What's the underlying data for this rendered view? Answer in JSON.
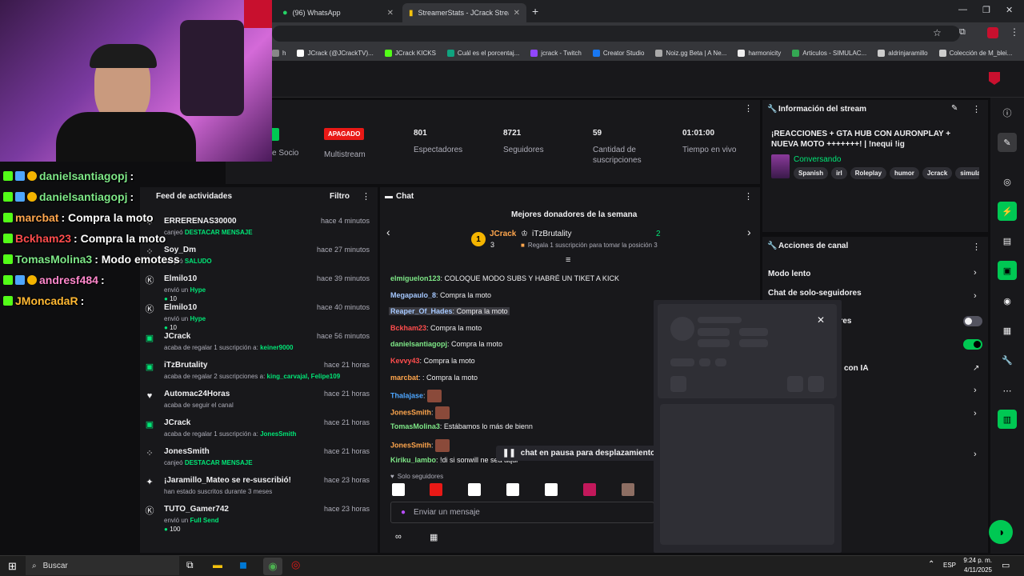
{
  "browser": {
    "tabs": [
      {
        "label": "(96) WhatsApp",
        "icon": "whatsapp-icon",
        "color": "#25d366"
      },
      {
        "label": "StreamerStats - JCrack Stream I",
        "icon": "streamerstats-icon",
        "color": "#f4c20d"
      }
    ],
    "new_tab": "+",
    "bookmarks": [
      {
        "label": "h",
        "color": "#888"
      },
      {
        "label": "JCrack (@JCrackTV)...",
        "color": "#fff"
      },
      {
        "label": "JCrack KICKS",
        "color": "#53fc18"
      },
      {
        "label": "Cuál es el porcentaj...",
        "color": "#10a37f"
      },
      {
        "label": "jcrack - Twitch",
        "color": "#9146ff"
      },
      {
        "label": "Creator Studio",
        "color": "#1877f2"
      },
      {
        "label": "Noiz.gg Beta | A Ne...",
        "color": "#aaa"
      },
      {
        "label": "harmonicity",
        "color": "#eee"
      },
      {
        "label": "Articulos - SIMULAC...",
        "color": "#34a853"
      },
      {
        "label": "aldrinjaramillo",
        "color": "#ccc"
      },
      {
        "label": "Colección de M_blei...",
        "color": "#ccc"
      }
    ]
  },
  "stats": {
    "partner_label": "e Socio",
    "multistream_badge": "APAGADO",
    "multistream_label": "Multistream",
    "items": [
      {
        "value": "801",
        "label": "Espectadores"
      },
      {
        "value": "8721",
        "label": "Seguidores"
      },
      {
        "value": "59",
        "label": "Cantidad de suscripciones"
      },
      {
        "value": "01:01:00",
        "label": "Tiempo en vivo"
      }
    ]
  },
  "stream_info": {
    "title": "Información del stream",
    "stream_title": "¡REACCIONES + GTA HUB CON AURONPLAY + NUEVA MOTO +++++++! | !nequi !ig",
    "category": "Conversando",
    "tags": [
      "Spanish",
      "irl",
      "Roleplay",
      "humor",
      "Jcrack",
      "simula"
    ]
  },
  "channel_actions": {
    "title": "Acciones de canal",
    "items": [
      "Modo lento",
      "Chat de solo-seguidores",
      "tores",
      "con IA"
    ]
  },
  "feed": {
    "title": "Feed de actividades",
    "filter": "Filtro",
    "items": [
      {
        "name": "ERRERENAS30000",
        "time": "hace 4 minutos",
        "desc": "canjeó",
        "highlight": "DESTACAR MENSAJE",
        "icon": "channel-points-icon"
      },
      {
        "name": "Soy_Dm",
        "time": "hace 27 minutos",
        "desc": "canjeó",
        "highlight": "SALUDO",
        "icon": "channel-points-icon"
      },
      {
        "name": "Elmilo10",
        "time": "hace 39 minutos",
        "desc": "envió un",
        "highlight": "Hype",
        "extra": "10",
        "icon": "kick-icon"
      },
      {
        "name": "Elmilo10",
        "time": "hace 40 minutos",
        "desc": "envió un",
        "highlight": "Hype",
        "extra": "10",
        "icon": "kick-icon"
      },
      {
        "name": "JCrack",
        "time": "hace 56 minutos",
        "desc": "acaba de regalar 1 suscripción a:",
        "highlight": "keiner9000",
        "icon": "gift-icon"
      },
      {
        "name": "iTzBrutality",
        "time": "hace 21 horas",
        "desc": "acaba de regalar 2 suscripciones a:",
        "highlight": "king_carvajal, Felipe109",
        "icon": "gift-icon"
      },
      {
        "name": "Automac24Horas",
        "time": "hace 21 horas",
        "desc": "acaba de seguir el canal",
        "highlight": "",
        "icon": "heart-icon"
      },
      {
        "name": "JCrack",
        "time": "hace 21 horas",
        "desc": "acaba de regalar 1 suscripción a:",
        "highlight": "JonesSmith",
        "icon": "gift-icon"
      },
      {
        "name": "JonesSmith",
        "time": "hace 21 horas",
        "desc": "canjeó",
        "highlight": "DESTACAR MENSAJE",
        "icon": "channel-points-icon"
      },
      {
        "name": "¡Jaramillo_Mateo se re-suscribió!",
        "time": "hace 23 horas",
        "desc": "han estado suscritos durante 3 meses",
        "highlight": "",
        "icon": "star-icon"
      },
      {
        "name": "TUTO_Gamer742",
        "time": "hace 23 horas",
        "desc": "envió un",
        "highlight": "Full Send",
        "extra": "100",
        "icon": "kick-icon"
      }
    ]
  },
  "chat": {
    "title": "Chat",
    "donors_title": "Mejores donadores de la semana",
    "donor1_name": "JCrack",
    "donor1_count": "3",
    "donor2_name": "iTzBrutality",
    "donor2_count": "2",
    "donor_cta": "Regala 1 suscripción para tomar la posición 3",
    "messages": [
      {
        "user": "elmiguelon123",
        "color": "#7ee787",
        "text": "COLOQUE MODO SUBS Y HABRÉ UN TIKET A KICK"
      },
      {
        "user": "Megapaulo_8",
        "color": "#a5c8ff",
        "text": "Compra la moto"
      },
      {
        "user": "Reaper_Of_Hades",
        "color": "#a5c8ff",
        "text": "Compra la moto"
      },
      {
        "user": "Bckham23",
        "color": "#ff4d4d",
        "text": "Compra la moto"
      },
      {
        "user": "danielsantiagopj",
        "color": "#7ee787",
        "text": "Compra la moto"
      },
      {
        "user": "Kevvy43",
        "color": "#ff4d4d",
        "text": "Compra la moto"
      },
      {
        "user": "marcbat",
        "color": "#ffa64d",
        "text": ": Compra la moto"
      },
      {
        "user": "Thalajase",
        "color": "#4da6ff",
        "text": ""
      },
      {
        "user": "JonesSmith",
        "color": "#ffa64d",
        "text": ""
      },
      {
        "user": "TomasMolina3",
        "color": "#7ee787",
        "text": "Estábamos lo más de bienn"
      },
      {
        "user": "JonesSmith",
        "color": "#ffa64d",
        "text": ""
      },
      {
        "user": "Kiriku_lambo",
        "color": "#7ee787",
        "text": "!di si sonwill ne sea aqui"
      }
    ],
    "paused": "chat en pausa para desplazamiento",
    "followers_only": "Solo seguidores",
    "input_placeholder": "Enviar un mensaje"
  },
  "overlay_chat": [
    {
      "user": "danielsantiagopj",
      "color": "#7ee787",
      "text": ":"
    },
    {
      "user": "danielsantiagopj",
      "color": "#7ee787",
      "text": ":"
    },
    {
      "user": "marcbat",
      "color": "#ffa64d",
      "text": ": Compra la moto"
    },
    {
      "user": "Bckham23",
      "color": "#ff4d4d",
      "text": ": Compra la moto"
    },
    {
      "user": "TomasMolina3",
      "color": "#7ee787",
      "text": ": Modo emotess"
    },
    {
      "user": "andresf484",
      "color": "#ff88cc",
      "text": ":"
    },
    {
      "user": "JMoncadaR",
      "color": "#ffb833",
      "text": ":"
    }
  ],
  "taskbar": {
    "search": "Buscar",
    "lang": "ESP",
    "time": "9:24 p. m.",
    "date": "4/11/2025"
  }
}
